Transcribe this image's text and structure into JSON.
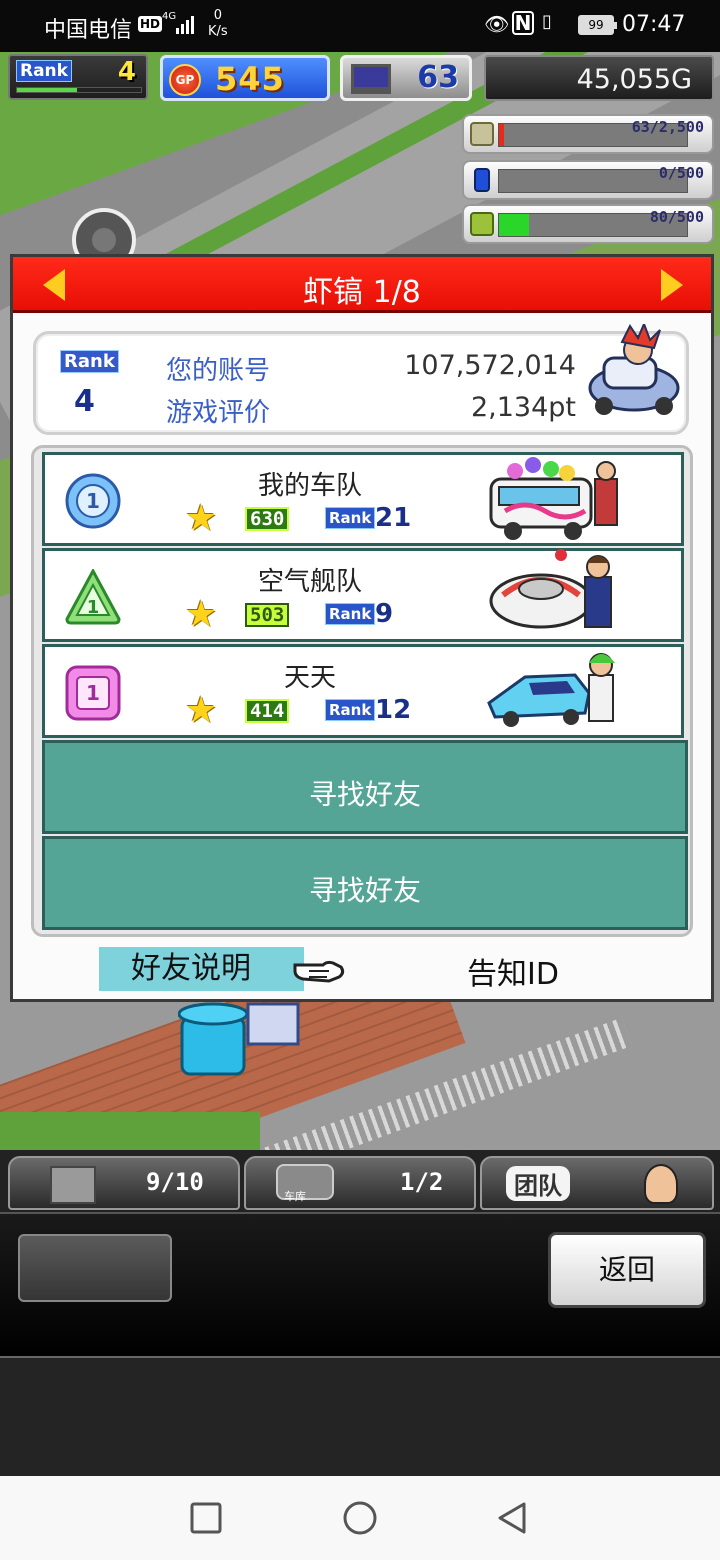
{
  "status_bar": {
    "carrier": "中国电信",
    "hd": "HD",
    "network": "4G",
    "speed_value": "0",
    "speed_unit": "K/s",
    "battery": "99",
    "time": "07:47"
  },
  "hud": {
    "rank_label": "Rank",
    "rank_value": "4",
    "gp_icon_label": "GP",
    "gp_value": "545",
    "pc_value": "63",
    "money": "45,055G",
    "resources": [
      {
        "icon": "coins-icon",
        "text": "63/2,500",
        "level": 0.025,
        "color": "#e82a1a"
      },
      {
        "icon": "fuel-icon",
        "text": "0/500",
        "level": 0.0,
        "color": "#3a8bff"
      },
      {
        "icon": "wheat-icon",
        "text": "80/500",
        "level": 0.16,
        "color": "#2bd62a"
      }
    ]
  },
  "dialog": {
    "title": "虾镐 1/8",
    "account": {
      "rank_label": "Rank",
      "rank_value": "4",
      "account_label": "您的账号",
      "account_value": "107,572,014",
      "rating_label": "游戏评价",
      "rating_value": "2,134pt"
    },
    "friends": [
      {
        "badge": "1",
        "badge_shape": "circle",
        "name": "我的车队",
        "score": "630",
        "rank_label": "Rank",
        "rank": "21"
      },
      {
        "badge": "1",
        "badge_shape": "triangle",
        "name": "空气舰队",
        "score": "503",
        "rank_label": "Rank",
        "rank": "9"
      },
      {
        "badge": "1",
        "badge_shape": "square",
        "name": "天天",
        "score": "414",
        "rank_label": "Rank",
        "rank": "12"
      }
    ],
    "find_friend_slots": [
      "寻找好友",
      "寻找好友"
    ],
    "friend_help": "好友说明",
    "notify_id": "告知ID"
  },
  "bottom": {
    "tab1_count": "9/10",
    "tab2_sub": "车库",
    "tab2_count": "1/2",
    "tab3_label": "团队",
    "back": "返回"
  }
}
